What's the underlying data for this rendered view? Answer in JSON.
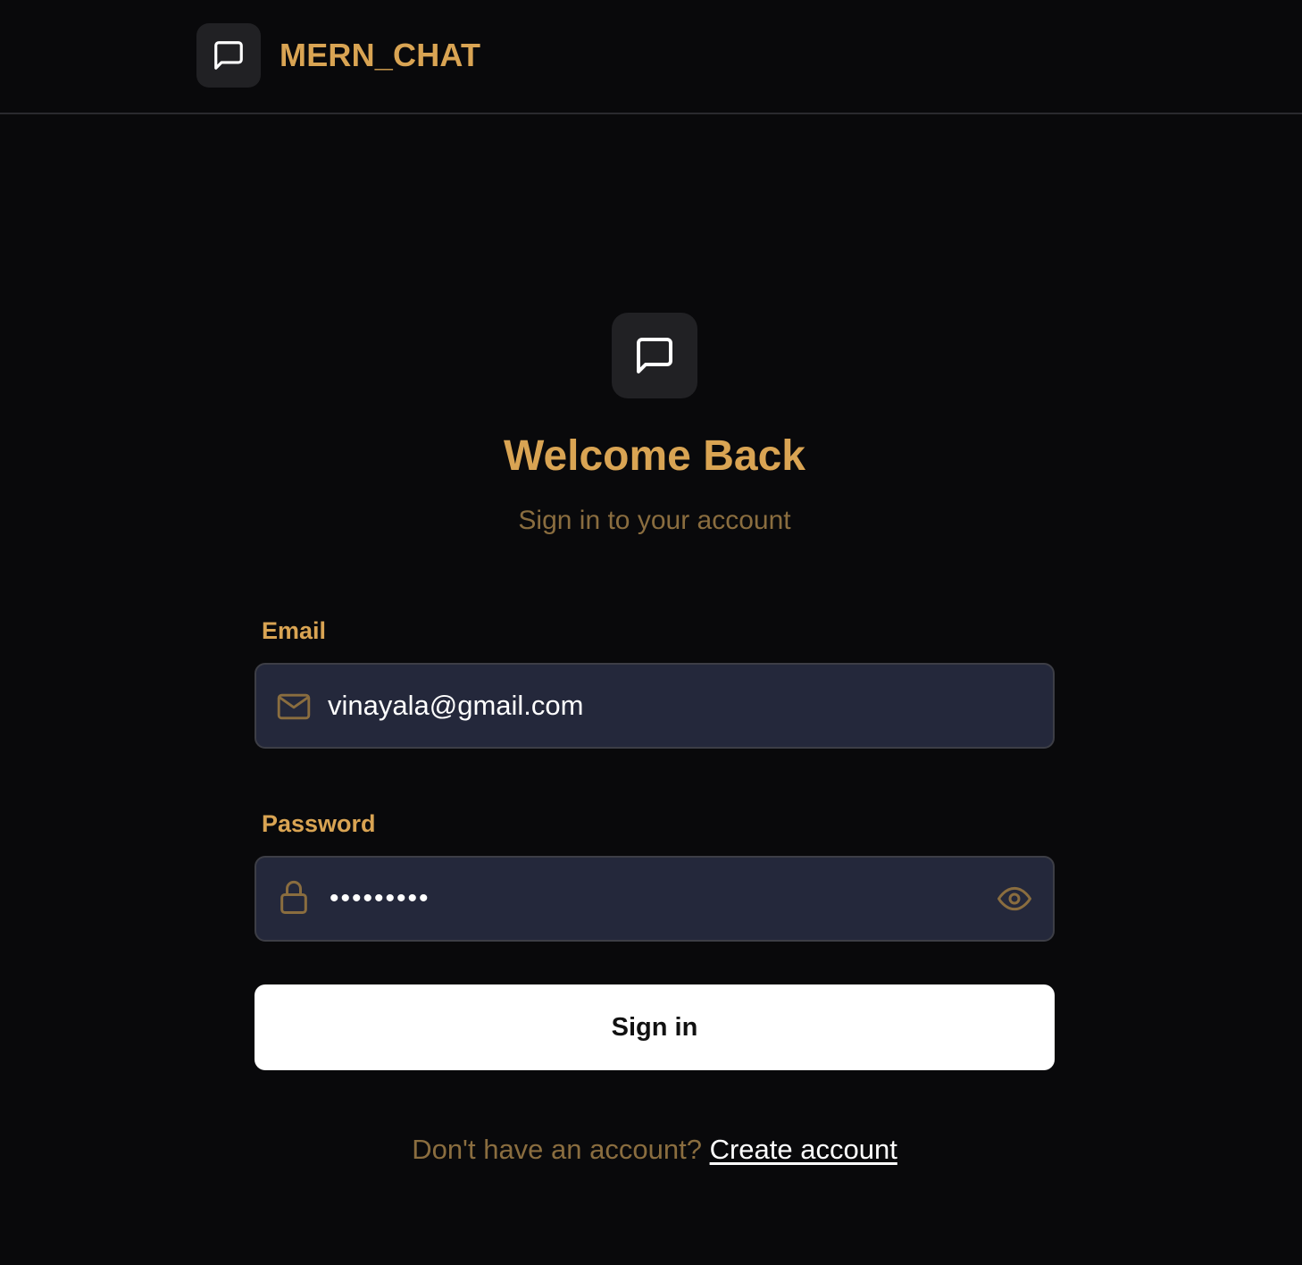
{
  "colors": {
    "background": "#09090b",
    "accent_gold": "#d9a453",
    "muted_gold": "#8a6d3f",
    "input_bg": "#24283b",
    "icon_box_bg": "#212124"
  },
  "navbar": {
    "logo_icon": "chat-bubble-icon",
    "title": "MERN_CHAT"
  },
  "hero": {
    "icon": "chat-bubble-icon",
    "heading": "Welcome Back",
    "subheading": "Sign in to your account"
  },
  "form": {
    "email": {
      "label": "Email",
      "icon": "mail-icon",
      "value": "vinayala@gmail.com"
    },
    "password": {
      "label": "Password",
      "icon": "lock-icon",
      "masked_value": "•••••••••",
      "toggle_icon": "eye-icon"
    },
    "submit_label": "Sign in"
  },
  "footer": {
    "prompt": "Don't have an account?",
    "link_label": "Create account"
  }
}
